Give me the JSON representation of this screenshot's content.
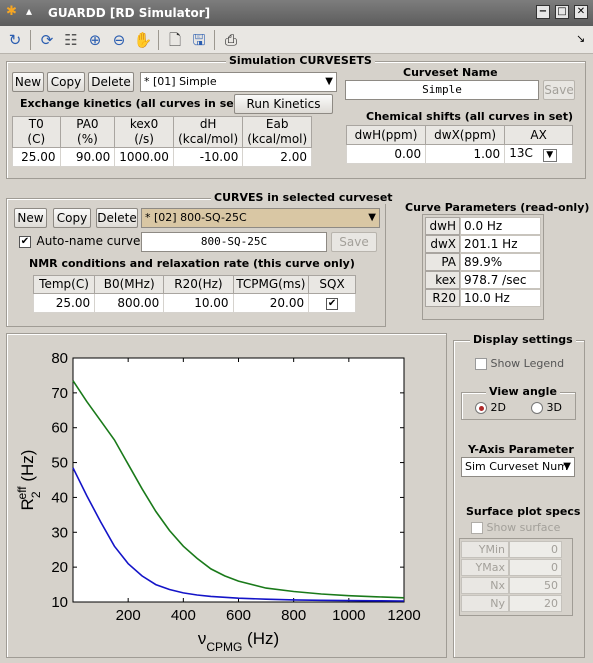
{
  "window": {
    "title": "GUARDD [RD Simulator]",
    "btn_min": "−",
    "btn_max": "□",
    "btn_close": "✕"
  },
  "toolbar": {
    "icons": [
      "dock-icon",
      "rotate-icon",
      "data-cursor-icon",
      "zoom-in-icon",
      "zoom-out-icon",
      "pan-icon",
      "new-figure-icon",
      "save-icon",
      "export-icon"
    ],
    "arrow_glyph": "↘"
  },
  "curvesets": {
    "title": "Simulation CURVESETS",
    "new_label": "New",
    "copy_label": "Copy",
    "delete_label": "Delete",
    "selected": "* [01] Simple",
    "exchange_title": "Exchange kinetics (all curves in set)",
    "run_label": "Run Kinetics Sim",
    "kinetics_headers": [
      [
        "T0",
        "(C)"
      ],
      [
        "PA0",
        "(%)"
      ],
      [
        "kex0",
        "(/s)"
      ],
      [
        "dH",
        "(kcal/mol)"
      ],
      [
        "Eab",
        "(kcal/mol)"
      ]
    ],
    "kinetics_values": [
      "25.00",
      "90.00",
      "1000.00",
      "-10.00",
      "2.00"
    ],
    "name_title": "Curveset Name",
    "name_value": "Simple",
    "save_label": "Save",
    "shifts_title": "Chemical shifts (all curves in set)",
    "shift_headers": [
      "dwH(ppm)",
      "dwX(ppm)",
      "AX"
    ],
    "shift_values": [
      "0.00",
      "1.00",
      "13C"
    ]
  },
  "curves": {
    "title": "CURVES in selected curveset",
    "new_label": "New",
    "copy_label": "Copy",
    "delete_label": "Delete",
    "selected": "* [02] 800-SQ-25C",
    "autoname_label": "Auto-name curve",
    "autoname_checked": "✔",
    "name_value": "800-SQ-25C",
    "save_label": "Save",
    "nmr_title": "NMR conditions and relaxation rate (this curve only)",
    "nmr_headers": [
      "Temp(C)",
      "B0(MHz)",
      "R20(Hz)",
      "TCPMG(ms)",
      "SQX"
    ],
    "nmr_values": [
      "25.00",
      "800.00",
      "10.00",
      "20.00",
      "✔"
    ]
  },
  "params": {
    "title": "Curve Parameters (read-only)",
    "rows": [
      {
        "label": "dwH",
        "value": "0.0 Hz"
      },
      {
        "label": "dwX",
        "value": "201.1 Hz"
      },
      {
        "label": "PA",
        "value": "89.9%"
      },
      {
        "label": "kex",
        "value": "978.7 /sec"
      },
      {
        "label": "R20",
        "value": "10.0 Hz"
      }
    ]
  },
  "display": {
    "title": "Display settings",
    "show_legend": "Show Legend",
    "view_angle_title": "View angle",
    "view_2d": "2D",
    "view_3d": "3D",
    "yaxis_title": "Y-Axis Parameter",
    "yaxis_selected": "Sim Curveset Num",
    "surface_title": "Surface plot specs",
    "show_surface": "Show surface",
    "surface_rows": [
      {
        "label": "YMin",
        "value": "0"
      },
      {
        "label": "YMax",
        "value": "0"
      },
      {
        "label": "Nx",
        "value": "50"
      },
      {
        "label": "Ny",
        "value": "20"
      }
    ]
  },
  "chart_data": {
    "type": "line",
    "xlabel_main": "ν",
    "xlabel_sub": "CPMG",
    "xlabel_unit": " (Hz)",
    "ylabel_main": "R",
    "ylabel_sub": "2",
    "ylabel_sup": "eff",
    "ylabel_unit": " (Hz)",
    "xlim": [
      0,
      1200
    ],
    "ylim": [
      10,
      80
    ],
    "xticks": [
      200,
      400,
      600,
      800,
      1000,
      1200
    ],
    "yticks": [
      10,
      20,
      30,
      40,
      50,
      60,
      70,
      80
    ],
    "grid": false,
    "series": [
      {
        "color": "#1a7a1a",
        "x": [
          0,
          50,
          100,
          150,
          200,
          250,
          300,
          350,
          400,
          450,
          500,
          550,
          600,
          700,
          800,
          900,
          1000,
          1100,
          1200
        ],
        "y": [
          73.5,
          67.5,
          62.0,
          56.5,
          49.5,
          42.5,
          36.0,
          30.5,
          26.0,
          22.5,
          19.5,
          17.5,
          16.0,
          14.0,
          13.0,
          12.3,
          11.8,
          11.5,
          11.2
        ]
      },
      {
        "color": "#1414c8",
        "x": [
          0,
          50,
          100,
          150,
          200,
          250,
          300,
          350,
          400,
          450,
          500,
          600,
          700,
          800,
          900,
          1000,
          1100,
          1200
        ],
        "y": [
          48.5,
          40.5,
          33.0,
          26.0,
          21.0,
          17.5,
          15.0,
          13.6,
          12.6,
          12.0,
          11.6,
          11.1,
          10.8,
          10.6,
          10.5,
          10.4,
          10.35,
          10.3
        ]
      }
    ]
  }
}
